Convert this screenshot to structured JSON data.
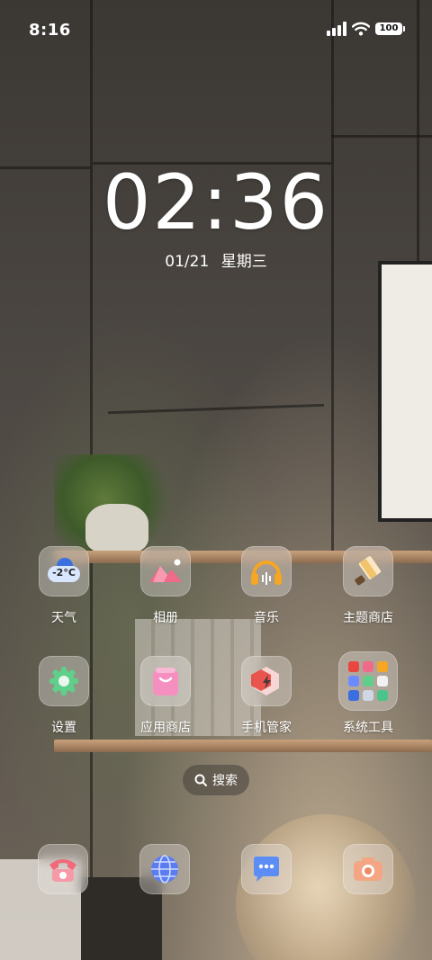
{
  "status_bar": {
    "time": "8:16",
    "battery": "100",
    "icons": [
      "signal-icon",
      "wifi-icon",
      "battery-icon"
    ]
  },
  "clock_widget": {
    "time": "02:36",
    "date": "01/21",
    "weekday": "星期三"
  },
  "apps": [
    {
      "label": "天气",
      "icon": "weather-icon",
      "temp": "-2°C"
    },
    {
      "label": "相册",
      "icon": "gallery-icon"
    },
    {
      "label": "音乐",
      "icon": "music-icon"
    },
    {
      "label": "主题商店",
      "icon": "themes-icon"
    },
    {
      "label": "设置",
      "icon": "settings-icon"
    },
    {
      "label": "应用商店",
      "icon": "app-store-icon"
    },
    {
      "label": "手机管家",
      "icon": "security-icon"
    },
    {
      "label": "系统工具",
      "icon": "folder-icon"
    }
  ],
  "search": {
    "label": "搜索",
    "icon": "search-icon"
  },
  "dock": [
    {
      "icon": "phone-icon"
    },
    {
      "icon": "browser-icon"
    },
    {
      "icon": "messages-icon"
    },
    {
      "icon": "camera-icon"
    }
  ],
  "colors": {
    "accent_blue": "#3b6fe0",
    "music_orange": "#f5a623",
    "security_red": "#e8463f",
    "gallery_pink": "#f06a8a"
  }
}
